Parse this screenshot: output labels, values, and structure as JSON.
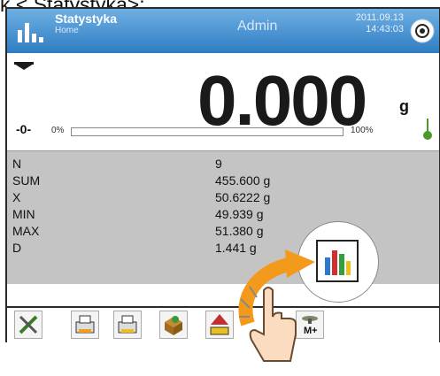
{
  "caption": {
    "text": "k <        Statystyka>:"
  },
  "header": {
    "title": "Statystyka",
    "subtitle": "Home",
    "user": "Admin",
    "date": "2011.09.13",
    "time": "14:43:03"
  },
  "weighing": {
    "value": "0.000",
    "unit": "g",
    "zero_marker": "-0-",
    "bar_min_label": "0%",
    "bar_max_label": "100%",
    "fill_fraction": 0.0
  },
  "stats": [
    {
      "label": "N",
      "value": "9"
    },
    {
      "label": "SUM",
      "value": "455.600 g"
    },
    {
      "label": "X",
      "value": "50.6222 g"
    },
    {
      "label": "MIN",
      "value": "49.939 g"
    },
    {
      "label": "MAX",
      "value": "51.380 g"
    },
    {
      "label": "D",
      "value": "1.441 g"
    }
  ],
  "colors": {
    "header_top": "#6fb0e4",
    "header_bottom": "#2f7cc2",
    "stats_bg": "#c4c4c4",
    "arrow": "#f39a1d"
  },
  "toolbar_icons": [
    "tools-icon",
    "printer-icon",
    "printer-alt-icon",
    "box-export-icon",
    "tare-icon",
    "memory-add-icon"
  ],
  "memory_button_label": "M+"
}
